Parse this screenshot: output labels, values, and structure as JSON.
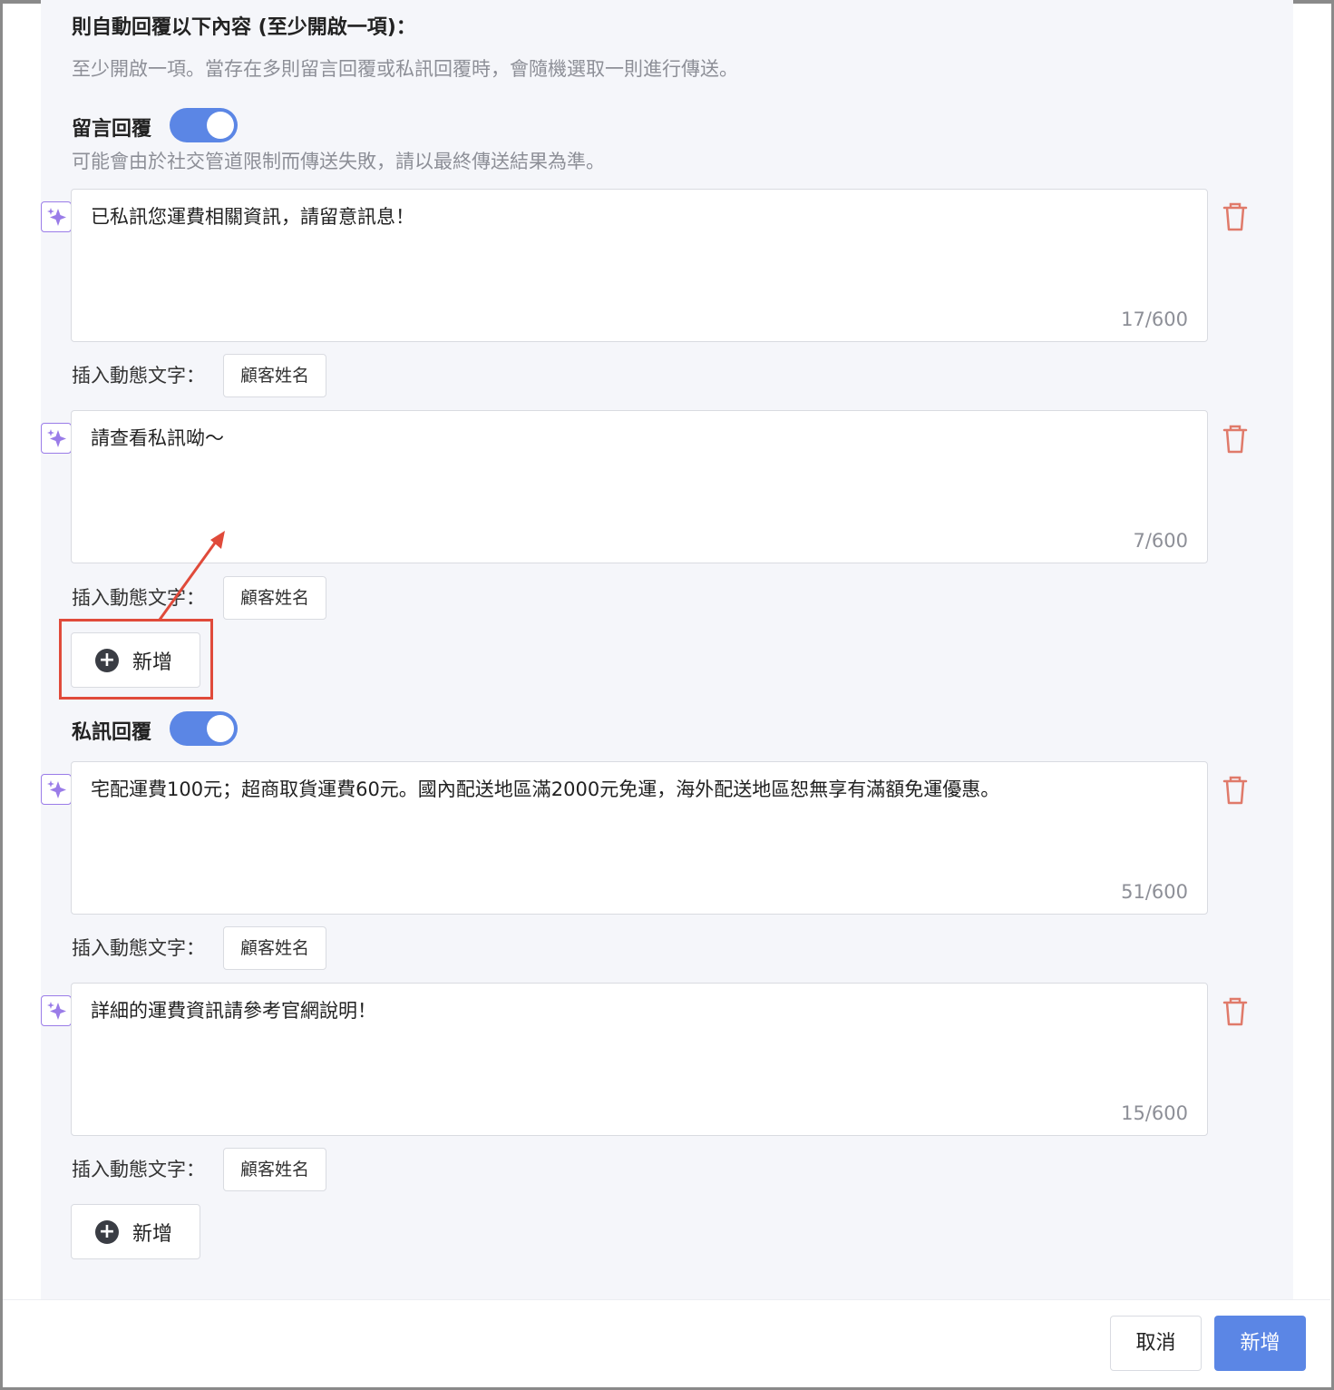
{
  "form": {
    "heading": "則自動回覆以下內容 (至少開啟一項)：",
    "hint": "至少開啟一項。當存在多則留言回覆或私訊回覆時，會隨機選取一則進行傳送。"
  },
  "comment_reply": {
    "title": "留言回覆",
    "enabled": true,
    "hint": "可能會由於社交管道限制而傳送失敗，請以最終傳送結果為準。",
    "messages": [
      {
        "text": "已私訊您運費相關資訊，請留意訊息！",
        "count": "17/600"
      },
      {
        "text": "請查看私訊呦～",
        "count": "7/600"
      }
    ],
    "add_label": "新增"
  },
  "dm_reply": {
    "title": "私訊回覆",
    "enabled": true,
    "messages": [
      {
        "text": "宅配運費100元；超商取貨運費60元。國內配送地區滿2000元免運，海外配送地區恕無享有滿額免運優惠。",
        "count": "51/600"
      },
      {
        "text": "詳細的運費資訊請參考官網說明！",
        "count": "15/600"
      }
    ],
    "add_label": "新增"
  },
  "dynamic_text": {
    "label": "插入動態文字：",
    "chip": "顧客姓名"
  },
  "footer": {
    "cancel_label": "取消",
    "submit_label": "新增"
  },
  "colors": {
    "accent": "#5b86e5",
    "highlight": "#e04a3a",
    "trash": "#e07a6a",
    "ai": "#9a7ce8"
  },
  "icons": [
    "ai-sparkle-icon",
    "trash-icon",
    "plus-circle-icon"
  ]
}
